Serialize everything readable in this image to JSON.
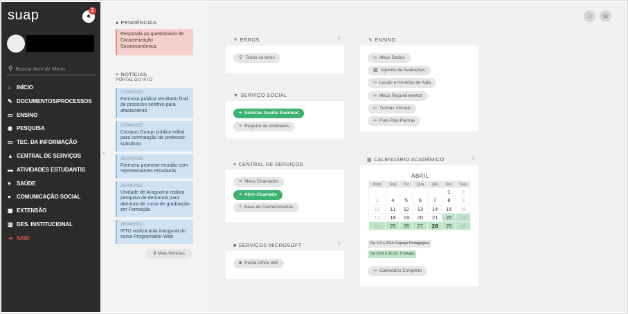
{
  "sidebar": {
    "brand": "suap",
    "notification_count": "2",
    "search_placeholder": "Buscar Item de Menu",
    "items": [
      {
        "icon": "home-icon",
        "glyph": "⌂",
        "label": "INÍCIO"
      },
      {
        "icon": "documents-icon",
        "glyph": "✎",
        "label": "DOCUMENTOS/PROCESSOS"
      },
      {
        "icon": "teaching-icon",
        "glyph": "▭",
        "label": "ENSINO"
      },
      {
        "icon": "globe-icon",
        "glyph": "◉",
        "label": "PESQUISA"
      },
      {
        "icon": "monitor-icon",
        "glyph": "▭",
        "label": "TEC. DA INFORMAÇÃO"
      },
      {
        "icon": "warning-icon",
        "glyph": "▲",
        "label": "CENTRAL DE SERVIÇOS"
      },
      {
        "icon": "graduation-icon",
        "glyph": "▬",
        "label": "ATIVIDADES ESTUDANTIS"
      },
      {
        "icon": "heart-icon",
        "glyph": "♥",
        "label": "SAÚDE"
      },
      {
        "icon": "speech-bubble-icon",
        "glyph": "●",
        "label": "COMUNICAÇÃO SOCIAL"
      },
      {
        "icon": "building-icon",
        "glyph": "▦",
        "label": "EXTENSÃO"
      },
      {
        "icon": "chart-icon",
        "glyph": "▥",
        "label": "DES. INSTITUCIONAL"
      },
      {
        "icon": "logout-icon",
        "glyph": "⇥",
        "label": "SAIR",
        "danger": true
      }
    ]
  },
  "pending": {
    "title": "PENDÊNCIAS",
    "items": [
      "Responda ao questionário de Caracterização Socioeconômica."
    ]
  },
  "news": {
    "title": "NOTÍCIAS",
    "subtitle": "PORTAL DO IFTO",
    "items": [
      {
        "date": "27/04/2022",
        "text": "Formoso publica resultado final de processo seletivo para afastamento"
      },
      {
        "date": "27/04/2022",
        "text": "Campus Gurupi publica edital para contratação de professor substituto"
      },
      {
        "date": "26/04/2022",
        "text": "Formoso promove reunião com representantes estudantis"
      },
      {
        "date": "26/04/2022",
        "text": "Unidade de Araguaína realiza pesquisa de demanda para abertura de curso de graduação em Formação"
      },
      {
        "date": "26/04/2022",
        "text": "IFTO realiza aula inaugural do curso Programador Web"
      }
    ],
    "more_label": "Mais Notícias"
  },
  "panels": {
    "erros": {
      "title": "ERROS",
      "buttons": [
        "Todos os erros"
      ]
    },
    "servico_social": {
      "title": "SERVIÇO SOCIAL",
      "buttons": [
        "Solicitar Auxílio Eventual",
        "Registro de Atividades"
      ]
    },
    "central": {
      "title": "CENTRAL DE SERVIÇOS",
      "buttons": [
        "Meus Chamados",
        "Abrir Chamado",
        "Base de Conhecimentos"
      ]
    },
    "microsoft": {
      "title": "SERVIÇOS MICROSOFT",
      "buttons": [
        "Portal Office 365"
      ]
    },
    "ensino": {
      "title": "ENSINO",
      "buttons": [
        "Meus Dados",
        "Agenda de Avaliações",
        "Locais e Horários de Aula",
        "Meus Requerimentos",
        "Turmas Virtuais",
        "Polo Polo Palmas"
      ]
    },
    "calendario": {
      "title": "CALENDÁRIO ACADÊMICO",
      "month": "ABRIL",
      "weekdays": [
        "Dom",
        "Seg",
        "Ter",
        "Qua",
        "Qui",
        "Sex",
        "Sab"
      ],
      "weeks": [
        [
          "",
          "",
          "",
          "",
          "",
          "1",
          "2"
        ],
        [
          "3",
          "4",
          "5",
          "6",
          "7",
          "8",
          "9"
        ],
        [
          "10",
          "11",
          "12",
          "13",
          "14",
          "15",
          "16"
        ],
        [
          "17",
          "18",
          "19",
          "20",
          "21",
          "22",
          "23"
        ],
        [
          "24",
          "25",
          "26",
          "27",
          "28",
          "29",
          "30"
        ]
      ],
      "today": "28",
      "events": [
        "De 1/4 a 20/4: Espaço Pedagógico",
        "De 22/4 a 31/12: 1ª Etapa"
      ],
      "full_calendar_label": "Calendário Completo"
    }
  },
  "colors": {
    "sidebar": "#2b2b2b",
    "accent_green": "#3cb371",
    "pending_bg": "#f4cfcb",
    "news_bg": "#cfe3f3",
    "danger": "#e4534b"
  }
}
